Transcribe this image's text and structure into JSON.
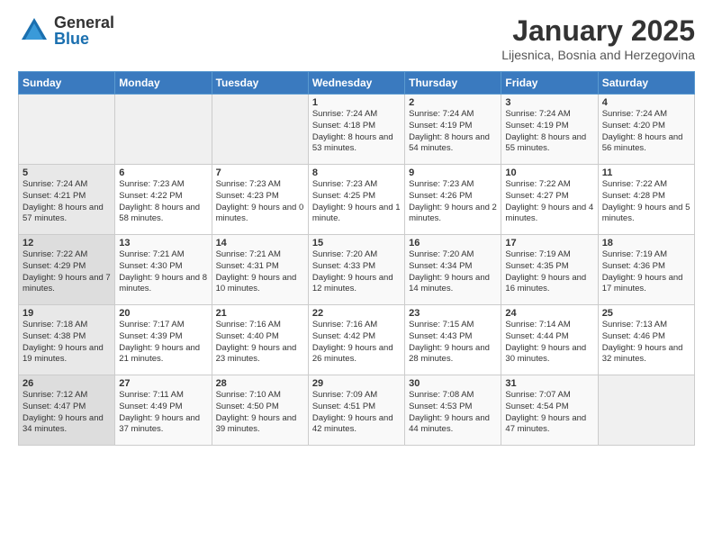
{
  "logo": {
    "general": "General",
    "blue": "Blue"
  },
  "title": "January 2025",
  "subtitle": "Lijesnica, Bosnia and Herzegovina",
  "headers": [
    "Sunday",
    "Monday",
    "Tuesday",
    "Wednesday",
    "Thursday",
    "Friday",
    "Saturday"
  ],
  "weeks": [
    [
      {
        "num": "",
        "info": ""
      },
      {
        "num": "",
        "info": ""
      },
      {
        "num": "",
        "info": ""
      },
      {
        "num": "1",
        "info": "Sunrise: 7:24 AM\nSunset: 4:18 PM\nDaylight: 8 hours\nand 53 minutes."
      },
      {
        "num": "2",
        "info": "Sunrise: 7:24 AM\nSunset: 4:19 PM\nDaylight: 8 hours\nand 54 minutes."
      },
      {
        "num": "3",
        "info": "Sunrise: 7:24 AM\nSunset: 4:19 PM\nDaylight: 8 hours\nand 55 minutes."
      },
      {
        "num": "4",
        "info": "Sunrise: 7:24 AM\nSunset: 4:20 PM\nDaylight: 8 hours\nand 56 minutes."
      }
    ],
    [
      {
        "num": "5",
        "info": "Sunrise: 7:24 AM\nSunset: 4:21 PM\nDaylight: 8 hours\nand 57 minutes."
      },
      {
        "num": "6",
        "info": "Sunrise: 7:23 AM\nSunset: 4:22 PM\nDaylight: 8 hours\nand 58 minutes."
      },
      {
        "num": "7",
        "info": "Sunrise: 7:23 AM\nSunset: 4:23 PM\nDaylight: 9 hours\nand 0 minutes."
      },
      {
        "num": "8",
        "info": "Sunrise: 7:23 AM\nSunset: 4:25 PM\nDaylight: 9 hours\nand 1 minute."
      },
      {
        "num": "9",
        "info": "Sunrise: 7:23 AM\nSunset: 4:26 PM\nDaylight: 9 hours\nand 2 minutes."
      },
      {
        "num": "10",
        "info": "Sunrise: 7:22 AM\nSunset: 4:27 PM\nDaylight: 9 hours\nand 4 minutes."
      },
      {
        "num": "11",
        "info": "Sunrise: 7:22 AM\nSunset: 4:28 PM\nDaylight: 9 hours\nand 5 minutes."
      }
    ],
    [
      {
        "num": "12",
        "info": "Sunrise: 7:22 AM\nSunset: 4:29 PM\nDaylight: 9 hours\nand 7 minutes."
      },
      {
        "num": "13",
        "info": "Sunrise: 7:21 AM\nSunset: 4:30 PM\nDaylight: 9 hours\nand 8 minutes."
      },
      {
        "num": "14",
        "info": "Sunrise: 7:21 AM\nSunset: 4:31 PM\nDaylight: 9 hours\nand 10 minutes."
      },
      {
        "num": "15",
        "info": "Sunrise: 7:20 AM\nSunset: 4:33 PM\nDaylight: 9 hours\nand 12 minutes."
      },
      {
        "num": "16",
        "info": "Sunrise: 7:20 AM\nSunset: 4:34 PM\nDaylight: 9 hours\nand 14 minutes."
      },
      {
        "num": "17",
        "info": "Sunrise: 7:19 AM\nSunset: 4:35 PM\nDaylight: 9 hours\nand 16 minutes."
      },
      {
        "num": "18",
        "info": "Sunrise: 7:19 AM\nSunset: 4:36 PM\nDaylight: 9 hours\nand 17 minutes."
      }
    ],
    [
      {
        "num": "19",
        "info": "Sunrise: 7:18 AM\nSunset: 4:38 PM\nDaylight: 9 hours\nand 19 minutes."
      },
      {
        "num": "20",
        "info": "Sunrise: 7:17 AM\nSunset: 4:39 PM\nDaylight: 9 hours\nand 21 minutes."
      },
      {
        "num": "21",
        "info": "Sunrise: 7:16 AM\nSunset: 4:40 PM\nDaylight: 9 hours\nand 23 minutes."
      },
      {
        "num": "22",
        "info": "Sunrise: 7:16 AM\nSunset: 4:42 PM\nDaylight: 9 hours\nand 26 minutes."
      },
      {
        "num": "23",
        "info": "Sunrise: 7:15 AM\nSunset: 4:43 PM\nDaylight: 9 hours\nand 28 minutes."
      },
      {
        "num": "24",
        "info": "Sunrise: 7:14 AM\nSunset: 4:44 PM\nDaylight: 9 hours\nand 30 minutes."
      },
      {
        "num": "25",
        "info": "Sunrise: 7:13 AM\nSunset: 4:46 PM\nDaylight: 9 hours\nand 32 minutes."
      }
    ],
    [
      {
        "num": "26",
        "info": "Sunrise: 7:12 AM\nSunset: 4:47 PM\nDaylight: 9 hours\nand 34 minutes."
      },
      {
        "num": "27",
        "info": "Sunrise: 7:11 AM\nSunset: 4:49 PM\nDaylight: 9 hours\nand 37 minutes."
      },
      {
        "num": "28",
        "info": "Sunrise: 7:10 AM\nSunset: 4:50 PM\nDaylight: 9 hours\nand 39 minutes."
      },
      {
        "num": "29",
        "info": "Sunrise: 7:09 AM\nSunset: 4:51 PM\nDaylight: 9 hours\nand 42 minutes."
      },
      {
        "num": "30",
        "info": "Sunrise: 7:08 AM\nSunset: 4:53 PM\nDaylight: 9 hours\nand 44 minutes."
      },
      {
        "num": "31",
        "info": "Sunrise: 7:07 AM\nSunset: 4:54 PM\nDaylight: 9 hours\nand 47 minutes."
      },
      {
        "num": "",
        "info": ""
      }
    ]
  ]
}
